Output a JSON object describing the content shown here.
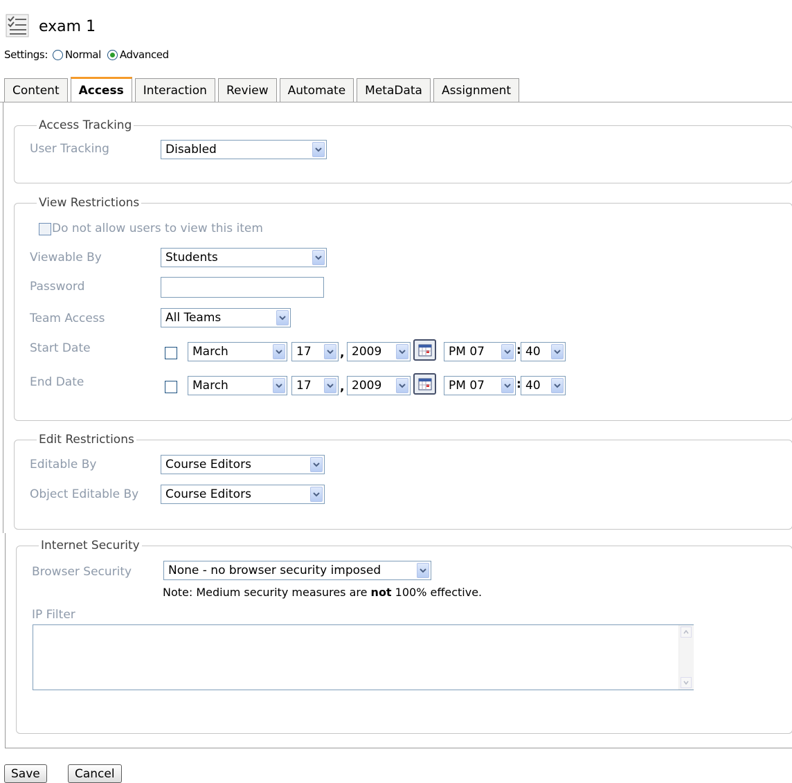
{
  "header": {
    "title": "exam 1",
    "icon": "checklist-icon"
  },
  "settings": {
    "label": "Settings:",
    "options": [
      "Normal",
      "Advanced"
    ],
    "selected": "Advanced"
  },
  "tabs": [
    "Content",
    "Access",
    "Interaction",
    "Review",
    "Automate",
    "MetaData",
    "Assignment"
  ],
  "active_tab": "Access",
  "access_tracking": {
    "legend": "Access Tracking",
    "user_tracking_label": "User Tracking",
    "user_tracking_value": "Disabled"
  },
  "view_restrictions": {
    "legend": "View Restrictions",
    "no_view_label": "Do not allow users to view this item",
    "viewable_by_label": "Viewable By",
    "viewable_by_value": "Students",
    "password_label": "Password",
    "password_value": "",
    "team_access_label": "Team Access",
    "team_access_value": "All Teams",
    "start_date": {
      "label": "Start Date",
      "month": "March",
      "day": "17",
      "year": "2009",
      "hour": "PM 07",
      "minute": "40"
    },
    "end_date": {
      "label": "End Date",
      "month": "March",
      "day": "17",
      "year": "2009",
      "hour": "PM 07",
      "minute": "40"
    },
    "comma": ",",
    "colon": ":"
  },
  "edit_restrictions": {
    "legend": "Edit Restrictions",
    "editable_by_label": "Editable By",
    "editable_by_value": "Course Editors",
    "object_editable_by_label": "Object Editable By",
    "object_editable_by_value": "Course Editors"
  },
  "internet_security": {
    "legend": "Internet Security",
    "browser_security_label": "Browser Security",
    "browser_security_value": "None - no browser security imposed",
    "note_prefix": "Note: Medium security measures are ",
    "note_bold": "not",
    "note_suffix": " 100% effective.",
    "ip_filter_label": "IP Filter",
    "ip_filter_value": ""
  },
  "buttons": {
    "save": "Save",
    "cancel": "Cancel"
  }
}
